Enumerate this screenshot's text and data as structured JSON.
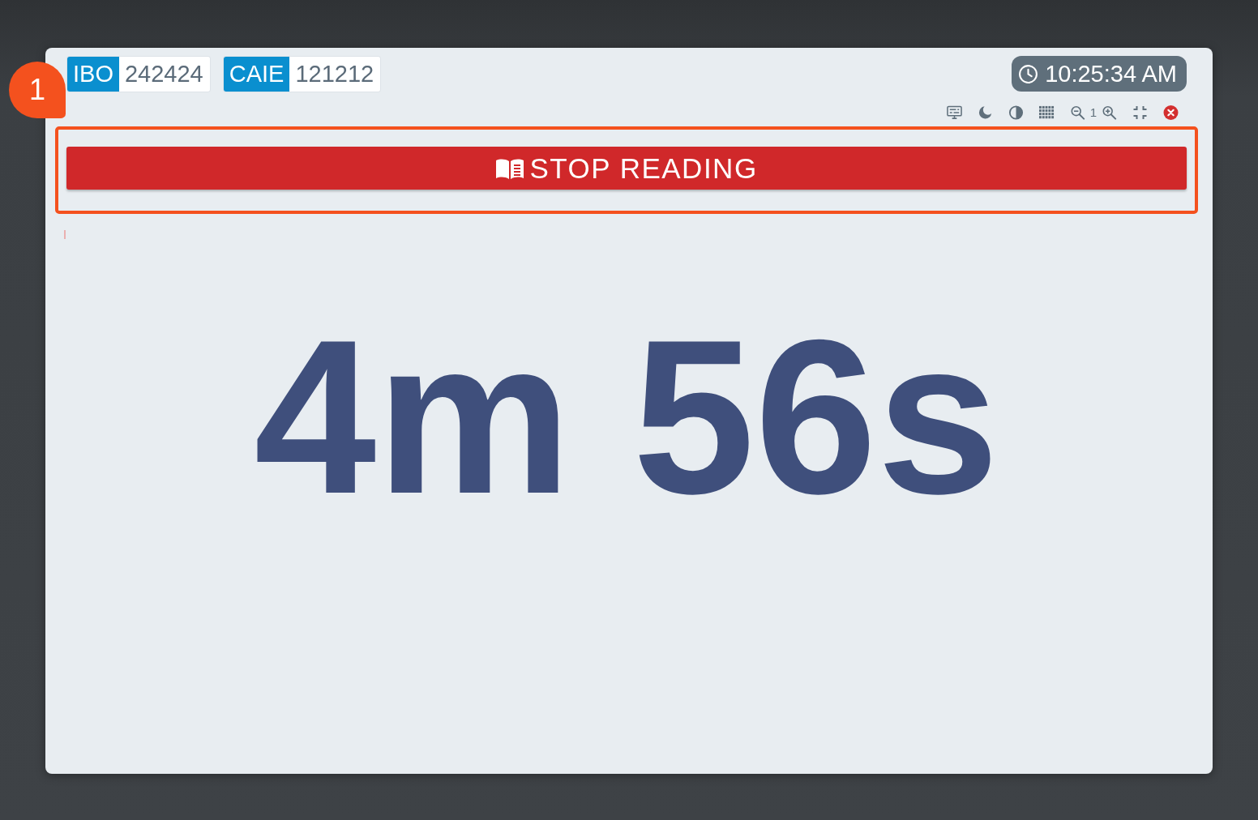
{
  "exam_boards": [
    {
      "label": "IBO",
      "value": "242424"
    },
    {
      "label": "CAIE",
      "value": "121212"
    }
  ],
  "clock": {
    "time": "10:25:34 AM"
  },
  "toolbar": {
    "zoom_level": "1"
  },
  "stop_button": {
    "label": "STOP READING"
  },
  "timer": {
    "text": "4m 56s"
  },
  "annotation": {
    "number": "1"
  }
}
